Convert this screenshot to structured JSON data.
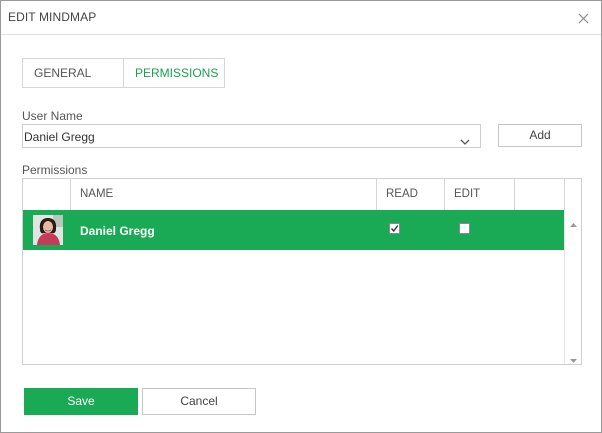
{
  "dialog": {
    "title": "EDIT MINDMAP"
  },
  "tabs": [
    {
      "label": "GENERAL",
      "active": false
    },
    {
      "label": "PERMISSIONS",
      "active": true
    }
  ],
  "user_field": {
    "label": "User Name",
    "value": "Daniel Gregg"
  },
  "add_button": {
    "label": "Add"
  },
  "permissions": {
    "label": "Permissions",
    "columns": [
      "",
      "NAME",
      "READ",
      "EDIT",
      ""
    ],
    "rows": [
      {
        "name": "Daniel Gregg",
        "read": true,
        "edit": false,
        "selected": true
      }
    ]
  },
  "actions": {
    "save_label": "Save",
    "cancel_label": "Cancel"
  },
  "colors": {
    "accent": "#1aaa55",
    "tab_active_text": "#1aa050"
  },
  "icons": {
    "close": "close-icon",
    "dropdown": "chevron-down-icon",
    "avatar": "user-avatar",
    "scroll_up": "scroll-up-arrow-icon",
    "scroll_down": "scroll-down-arrow-icon",
    "check": "checkmark-icon"
  }
}
